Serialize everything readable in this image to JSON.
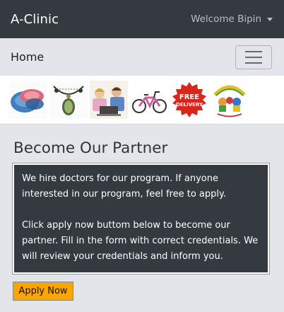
{
  "header": {
    "brand": "A-Clinic",
    "welcome": "Welcome Bipin"
  },
  "nav": {
    "home": "Home"
  },
  "banner": {
    "images": [
      "dishes-image",
      "necklace-image",
      "children-laptop-image",
      "bicycle-image",
      "free-delivery-badge",
      "child-care-centre-logo"
    ],
    "free_delivery_line1": "FREE",
    "free_delivery_line2": "DELIVERY"
  },
  "partner": {
    "title": "Become Our Partner",
    "paragraph1": "We hire doctors for our program. If anyone interested in our program, feel free to apply.",
    "paragraph2": "Click apply now buttom below to become our partner. Fill in the form with correct credentials. We will review your credentials and inform you.",
    "apply_label": "Apply Now"
  },
  "colors": {
    "navbar_dark": "#343a40",
    "page_bg": "#e4e5ea",
    "apply_button": "#f9a602",
    "badge_red": "#d8261c"
  }
}
